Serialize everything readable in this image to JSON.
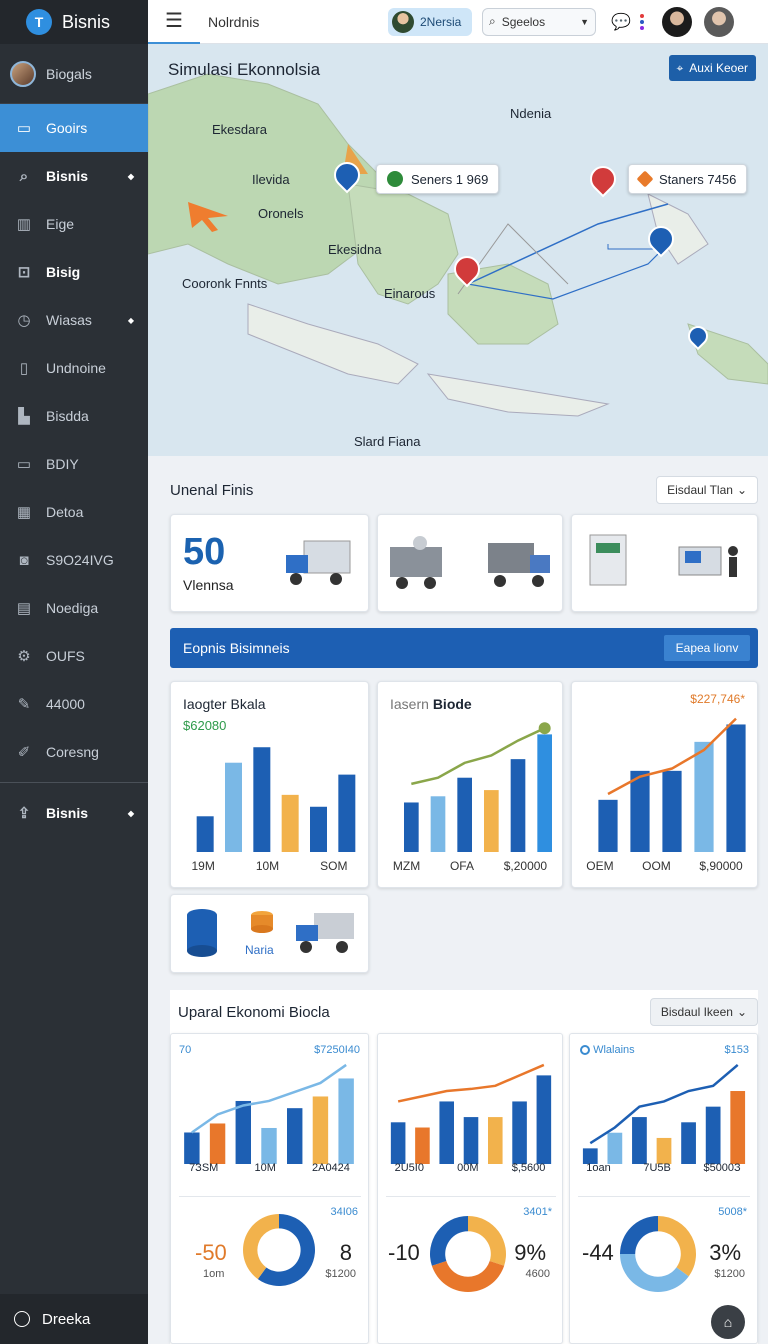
{
  "app": {
    "brand_name": "Bisnis",
    "brand_icon": "T"
  },
  "sidebar": {
    "profile_label": "Biogals",
    "items": [
      {
        "label": "Gooirs",
        "icon": "window-icon",
        "active": true
      },
      {
        "label": "Bisnis",
        "icon": "search-icon",
        "caret": true,
        "bold": true
      },
      {
        "label": "Eige",
        "icon": "building-icon"
      },
      {
        "label": "Bisig",
        "icon": "chart-box-icon",
        "bold": true
      },
      {
        "label": "Wiasas",
        "icon": "clock-icon",
        "caret": true
      },
      {
        "label": "Undnoine",
        "icon": "phone-icon"
      },
      {
        "label": "Bisdda",
        "icon": "bar-icon"
      },
      {
        "label": "BDIY",
        "icon": "card-icon"
      },
      {
        "label": "Detoa",
        "icon": "grid-icon"
      },
      {
        "label": "S9O24IVG",
        "icon": "camera-icon"
      },
      {
        "label": "Noediga",
        "icon": "doc-icon"
      },
      {
        "label": "OUFS",
        "icon": "gear-icon"
      },
      {
        "label": "44000",
        "icon": "tool-icon"
      },
      {
        "label": "Coresng",
        "icon": "pen-icon"
      }
    ],
    "extra_item": {
      "label": "Bisnis",
      "icon": "share-icon"
    },
    "bottom_label": "Dreeka"
  },
  "topbar": {
    "title": "Nolrdnis",
    "user_pill": "2Nersia",
    "search_label": "Sgeelos",
    "colors": {
      "accent": "#3c8fd6"
    }
  },
  "map": {
    "title": "Simulasi Ekonnolsia",
    "button": "Auxi Keoer",
    "labels": {
      "ekesdara": "Ekesdara",
      "ilevida": "Ilevida",
      "oronels": "Oronels",
      "ekesidna": "Ekesidna",
      "cooronk": "Cooronk Fnnts",
      "einarous": "Einarous",
      "ndenia": "Ndenia",
      "slard": "Slard Fiana"
    },
    "tip_left": "Seners 1 969",
    "tip_right": "Staners 7456"
  },
  "overview": {
    "title": "Unenal Finis",
    "dropdown": "Eisdaul Tlan",
    "stat_value": "50",
    "stat_label": "Vlennsa"
  },
  "business_bar": {
    "title": "Eopnis Bisimneis",
    "button": "Eapea lionv"
  },
  "charts": {
    "c1": {
      "title": "Iaogter Bkala",
      "sub": "$62080",
      "xlabels": [
        "19M",
        "10M",
        "SOM"
      ]
    },
    "c2": {
      "title_light": "Iasern",
      "title_bold": "Biode",
      "xlabels": [
        "MZM",
        "OFA",
        "$,20000"
      ]
    },
    "c3": {
      "top_value": "$227,746*",
      "xlabels": [
        "OEM",
        "OOM",
        "$,90000"
      ]
    }
  },
  "stack_card": {
    "label": "Naria"
  },
  "lower": {
    "title": "Uparal Ekonomi Biocla",
    "dropdown": "Bisdaul Ikeen",
    "mini": [
      {
        "tl": "70",
        "tr": "$7250I40",
        "xlabels": [
          "7ЗSM",
          "10M",
          "2A0424"
        ],
        "yticks": [
          "20",
          "10",
          "16",
          "51",
          "10"
        ]
      },
      {
        "tl": "",
        "tr": "",
        "xlabels": [
          "2U5I0",
          "00M",
          "$,5600"
        ],
        "yticks": [
          "10",
          "10",
          "16",
          "10",
          "10"
        ]
      },
      {
        "tl": "Wlalains",
        "tr": "$153",
        "xlabels": [
          "1oan",
          "7U5B",
          "$5000З"
        ],
        "yticks": [
          "10",
          "10",
          "7",
          "10",
          "10"
        ]
      }
    ],
    "donuts": [
      {
        "big": "-50",
        "small": "1om",
        "right": "8",
        "right2": "$1200",
        "tr": "34I06"
      },
      {
        "big": "-10",
        "small": "",
        "right": "9%",
        "right2": "4600",
        "tr": "3401*"
      },
      {
        "big": "-44",
        "small": "",
        "right": "3%",
        "right2": "$1200",
        "tr": "5008*"
      }
    ]
  },
  "chart_data": [
    {
      "type": "bar",
      "categories": [
        "1",
        "2",
        "3",
        "4",
        "5",
        "6"
      ],
      "values": [
        30,
        75,
        88,
        48,
        38,
        65
      ]
    },
    {
      "type": "bar",
      "categories": [
        "1",
        "2",
        "3",
        "4",
        "5",
        "6"
      ],
      "values": [
        40,
        45,
        60,
        50,
        75,
        95
      ],
      "line": [
        55,
        60,
        72,
        78,
        90,
        100
      ]
    },
    {
      "type": "bar",
      "categories": [
        "1",
        "2",
        "3",
        "4",
        "5"
      ],
      "values": [
        45,
        70,
        70,
        95,
        110
      ],
      "line": [
        50,
        65,
        72,
        88,
        115
      ]
    },
    {
      "type": "bar",
      "values": [
        35,
        45,
        70,
        40,
        62,
        75,
        95
      ],
      "line": [
        35,
        55,
        65,
        70,
        80,
        90,
        110
      ]
    },
    {
      "type": "bar",
      "values": [
        40,
        35,
        60,
        45,
        45,
        60,
        85
      ],
      "line": [
        60,
        65,
        70,
        72,
        75,
        85,
        95
      ]
    },
    {
      "type": "bar",
      "values": [
        15,
        30,
        45,
        25,
        40,
        55,
        70
      ],
      "line": [
        20,
        35,
        55,
        60,
        70,
        75,
        95
      ]
    },
    {
      "type": "pie",
      "values": [
        60,
        40
      ]
    },
    {
      "type": "pie",
      "values": [
        30,
        40,
        30
      ]
    },
    {
      "type": "pie",
      "values": [
        35,
        40,
        25
      ]
    }
  ]
}
